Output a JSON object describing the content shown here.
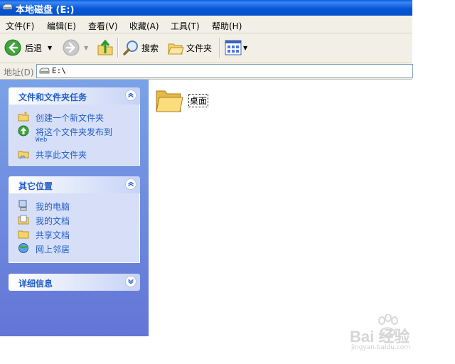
{
  "window": {
    "title": "本地磁盘 (E:)"
  },
  "menu": [
    "文件(F)",
    "编辑(E)",
    "查看(V)",
    "收藏(A)",
    "工具(T)",
    "帮助(H)"
  ],
  "toolbar": {
    "back_label": "后退",
    "search_label": "搜索",
    "folders_label": "文件夹"
  },
  "address": {
    "label": "地址(D)",
    "value": "E:\\"
  },
  "sidebar": {
    "file_tasks": {
      "title": "文件和文件夹任务",
      "items": [
        {
          "label": "创建一个新文件夹",
          "icon": "new-folder-icon"
        },
        {
          "label": "将这个文件夹发布到",
          "sub": "Web",
          "icon": "publish-web-icon"
        },
        {
          "label": "共享此文件夹",
          "icon": "share-folder-icon"
        }
      ]
    },
    "other_places": {
      "title": "其它位置",
      "items": [
        {
          "label": "我的电脑",
          "icon": "my-computer-icon"
        },
        {
          "label": "我的文档",
          "icon": "my-documents-icon"
        },
        {
          "label": "共享文档",
          "icon": "shared-documents-icon"
        },
        {
          "label": "网上邻居",
          "icon": "network-places-icon"
        }
      ]
    },
    "details": {
      "title": "详细信息"
    }
  },
  "files": [
    {
      "name": "桌面",
      "icon": "folder-icon"
    }
  ],
  "watermark": {
    "brand": "Bai 经验",
    "url": "jingyan.baidu.com"
  }
}
